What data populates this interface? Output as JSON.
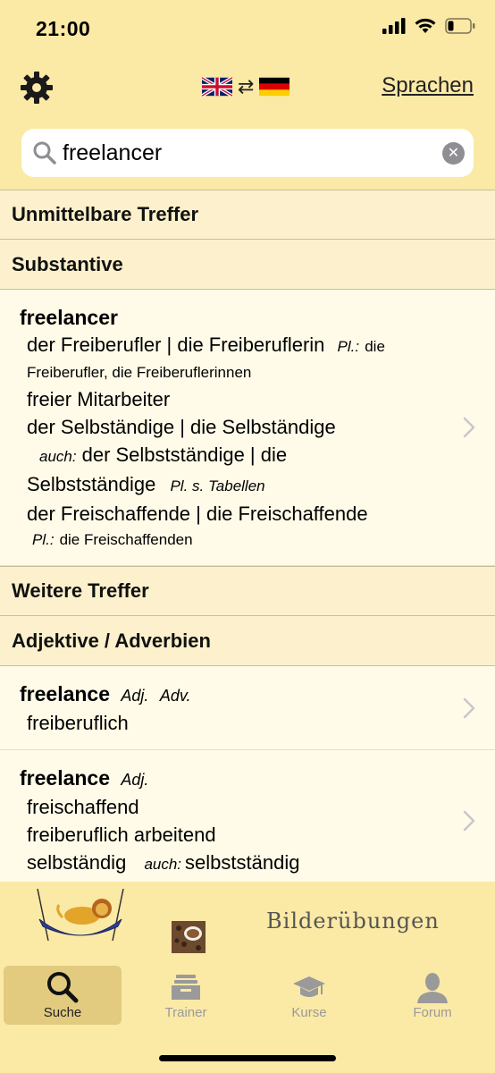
{
  "status": {
    "time": "21:00"
  },
  "nav": {
    "settings_icon": "gear-icon",
    "languages_label": "Sprachen",
    "source_flag": "uk-flag",
    "target_flag": "germany-flag"
  },
  "search": {
    "value": "freelancer",
    "placeholder": ""
  },
  "sections": {
    "direct_hits": "Unmittelbare Treffer",
    "nouns": "Substantive",
    "more_hits": "Weitere Treffer",
    "adjectives": "Adjektive / Adverbien"
  },
  "entry1": {
    "headword": "freelancer",
    "l1": "der Freiberufler | die Freiberuflerin",
    "l1_pl_label": "Pl.:",
    "l1_pl_a": "die",
    "l1_pl_b": "Freiberufler, die Freiberuflerinnen",
    "l2": "freier Mitarbeiter",
    "l3": "der Selbständige | die Selbständige",
    "l4_auch": "auch:",
    "l4": "der Selbstständige | die",
    "l5": "Selbstständige",
    "l5_pl": "Pl. s. Tabellen",
    "l6": "der Freischaffende | die Freischaffende",
    "l7_pl_label": "Pl.:",
    "l7_pl": "die Freischaffenden"
  },
  "entry2": {
    "headword": "freelance",
    "pos1": "Adj.",
    "pos2": "Adv.",
    "l1": "freiberuflich"
  },
  "entry3": {
    "headword": "freelance",
    "pos1": "Adj.",
    "l1": "freischaffend",
    "l2": "freiberuflich arbeitend",
    "l3": "selbständig",
    "l3_auch": "auch:",
    "l3b": "selbstständig"
  },
  "banner": {
    "text": "Bilderübungen"
  },
  "tabs": [
    {
      "label": "Suche",
      "icon": "search-icon"
    },
    {
      "label": "Trainer",
      "icon": "card-box-icon"
    },
    {
      "label": "Kurse",
      "icon": "graduation-cap-icon"
    },
    {
      "label": "Forum",
      "icon": "person-icon"
    }
  ],
  "colors": {
    "background": "#fbe9a6",
    "list_bg": "#fffbe8",
    "section_bg": "#fcf1cc",
    "active_tab": "#e2ca7f"
  }
}
